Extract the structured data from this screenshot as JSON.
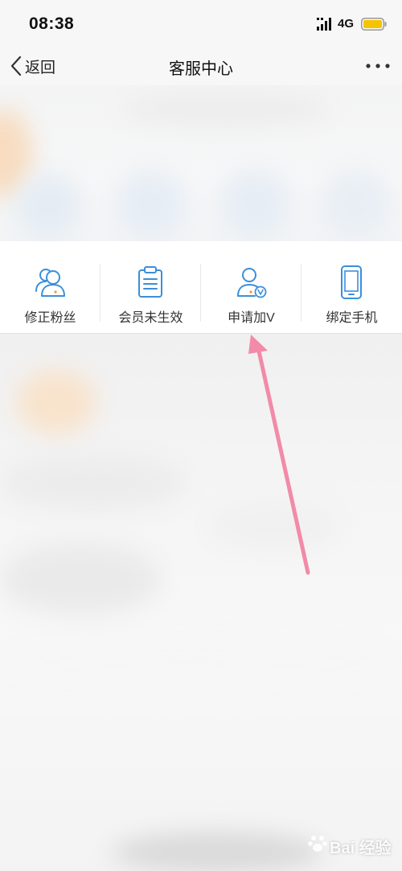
{
  "status_bar": {
    "time": "08:38",
    "network": "4G",
    "signal_icon": "signal-bars-icon",
    "battery_icon": "battery-icon",
    "battery_color": "#f5c400"
  },
  "nav": {
    "back_label": "返回",
    "title": "客服中心",
    "back_icon": "chevron-left-icon",
    "more_icon": "more-dots-icon"
  },
  "services": [
    {
      "label": "修正粉丝",
      "icon": "fans-icon"
    },
    {
      "label": "会员未生效",
      "icon": "clipboard-icon"
    },
    {
      "label": "申请加V",
      "icon": "verified-user-icon"
    },
    {
      "label": "绑定手机",
      "icon": "phone-icon"
    }
  ],
  "colors": {
    "icon_blue": "#3b8fd9",
    "arrow_pink": "#f28aa8"
  },
  "watermark": {
    "text": "Bai 经验"
  }
}
